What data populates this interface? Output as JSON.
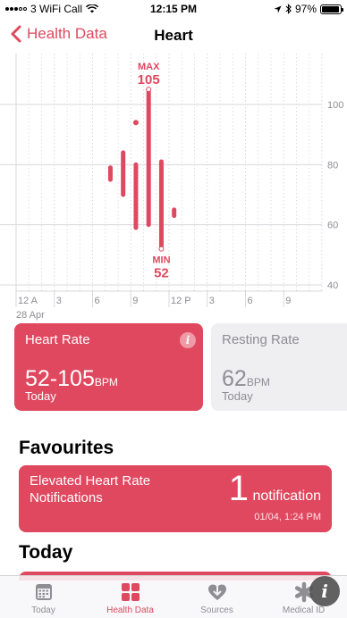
{
  "status_bar": {
    "carrier": "3 WiFi Call",
    "time": "12:15 PM",
    "battery": "97%",
    "battery_level": 0.97
  },
  "nav": {
    "back_label": "Health Data",
    "title": "Heart"
  },
  "chart_data": {
    "type": "range-bar",
    "x_tick_labels": [
      "12 A",
      "3",
      "6",
      "9",
      "12 P",
      "3",
      "6",
      "9"
    ],
    "x_date_label": "28 Apr",
    "y_tick_labels": [
      "100",
      "80",
      "60",
      "40"
    ],
    "y_ticks": [
      100,
      80,
      60,
      40
    ],
    "ylim": [
      40,
      118
    ],
    "xlim": [
      0,
      24
    ],
    "grid": true,
    "color": "#e0485f",
    "bars": [
      {
        "hour": 7.4,
        "min": 75,
        "max": 79
      },
      {
        "hour": 8.4,
        "min": 70,
        "max": 84
      },
      {
        "hour": 9.4,
        "min": 59,
        "max": 80
      },
      {
        "hour": 9.4,
        "min": 94,
        "max": 94
      },
      {
        "hour": 10.4,
        "min": 60,
        "max": 105
      },
      {
        "hour": 11.4,
        "min": 52,
        "max": 81
      },
      {
        "hour": 12.4,
        "min": 63,
        "max": 65
      }
    ],
    "max_annotation": {
      "label": "MAX",
      "value": "105",
      "hour": 10.4,
      "y": 105
    },
    "min_annotation": {
      "label": "MIN",
      "value": "52",
      "hour": 11.4,
      "y": 52
    }
  },
  "cards": {
    "heart_rate": {
      "title": "Heart Rate",
      "value": "52-105",
      "unit": "BPM",
      "sub": "Today"
    },
    "resting_rate": {
      "title": "Resting Rate",
      "value": "62",
      "unit": "BPM",
      "sub": "Today"
    }
  },
  "favourites": {
    "heading": "Favourites",
    "card": {
      "title": "Elevated Heart Rate Notifications",
      "count": "1",
      "count_label": "notification",
      "date": "01/04, 1:24 PM"
    }
  },
  "today": {
    "heading": "Today"
  },
  "tab_bar": {
    "tabs": [
      {
        "label": "Today",
        "icon": "calendar-icon"
      },
      {
        "label": "Health Data",
        "icon": "grid-icon"
      },
      {
        "label": "Sources",
        "icon": "heart-download-icon"
      },
      {
        "label": "Medical ID",
        "icon": "asterisk-icon"
      }
    ]
  },
  "colors": {
    "accent": "#e0485f",
    "card_inactive": "#efeff2",
    "grid": "#d8d8dd"
  }
}
